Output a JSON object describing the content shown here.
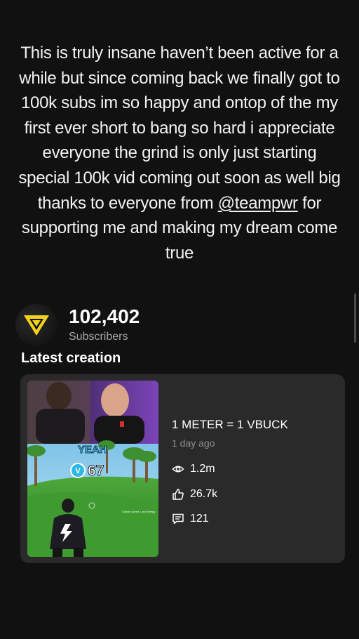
{
  "story": {
    "caption_before_mention": "This is truly insane haven’t been active for a while but since coming back we finally got to 100k subs im so happy and ontop of the my first ever short to bang so hard i appreciate everyone the grind is only just starting special 100k vid coming out soon as well big thanks to everyone from ",
    "mention": "@teampwr",
    "caption_after_mention": " for supporting me and making my dream come true"
  },
  "channel": {
    "subscriber_count": "102,402",
    "subscriber_label": "Subscribers",
    "logo_icon": "v-logo-icon",
    "logo_color": "#f3d21c"
  },
  "latest": {
    "section_title": "Latest creation",
    "video": {
      "title": "1 METER = 1 VBUCK",
      "age": "1 day ago",
      "views": "1.2m",
      "likes": "26.7k",
      "comments": "121",
      "thumbnail": {
        "overlay_word": "YEAH",
        "vbuck_count": "67",
        "small_text": "Cancel Sprint, Low Energy"
      }
    }
  }
}
